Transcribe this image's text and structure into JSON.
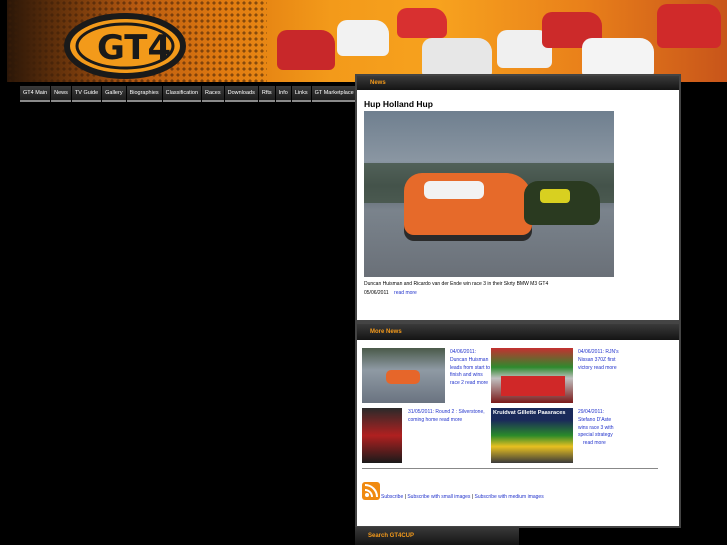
{
  "site": {
    "logo_text": "GT4"
  },
  "nav": {
    "items": [
      "GT4 Main",
      "News",
      "TV Guide",
      "Gallery",
      "Biographies",
      "Classification",
      "Races",
      "Downloads",
      "Rfts",
      "Info",
      "Links",
      "GT Marketplace"
    ]
  },
  "news_panel": {
    "heading": "News",
    "story": {
      "title": "Hup Holland Hup",
      "caption": "Duncan Huisman and Ricardo van der Ende win race 3 in their Skrty BMW M3 GT4",
      "date": "05/06/2011",
      "read_more": "read more"
    }
  },
  "more_news": {
    "heading": "More News",
    "items": [
      {
        "date": "04/06/2011:",
        "lines": [
          "Duncan Huisman",
          "leads from start to",
          "finish and wins",
          "race 2"
        ],
        "read_more": "read more"
      },
      {
        "date": "04/06/2011: RJN's",
        "lines": [
          "Nissan 370Z first",
          "victory"
        ],
        "read_more": "read more"
      },
      {
        "date": "31/05/2011: Round 2 : Silverstone,",
        "lines": [
          "coming home"
        ],
        "read_more": "read more"
      },
      {
        "date": "29/04/2011:",
        "lines": [
          "Stefano D'Aste",
          "wins race 3 with",
          "special strategy"
        ],
        "read_more": "read more"
      }
    ],
    "podium_banner": "Kruidvat Gillette Paasraces",
    "subscribe": {
      "subscribe": "Subscribe",
      "small": "Subscribe with small images",
      "medium": "Subscribe with medium images",
      "sep": "|"
    }
  },
  "search": {
    "heading": "Search GT4CUP"
  },
  "colors": {
    "accent": "#f59a1a",
    "link": "#2233cc",
    "panel_head": "#1e1e1e"
  }
}
